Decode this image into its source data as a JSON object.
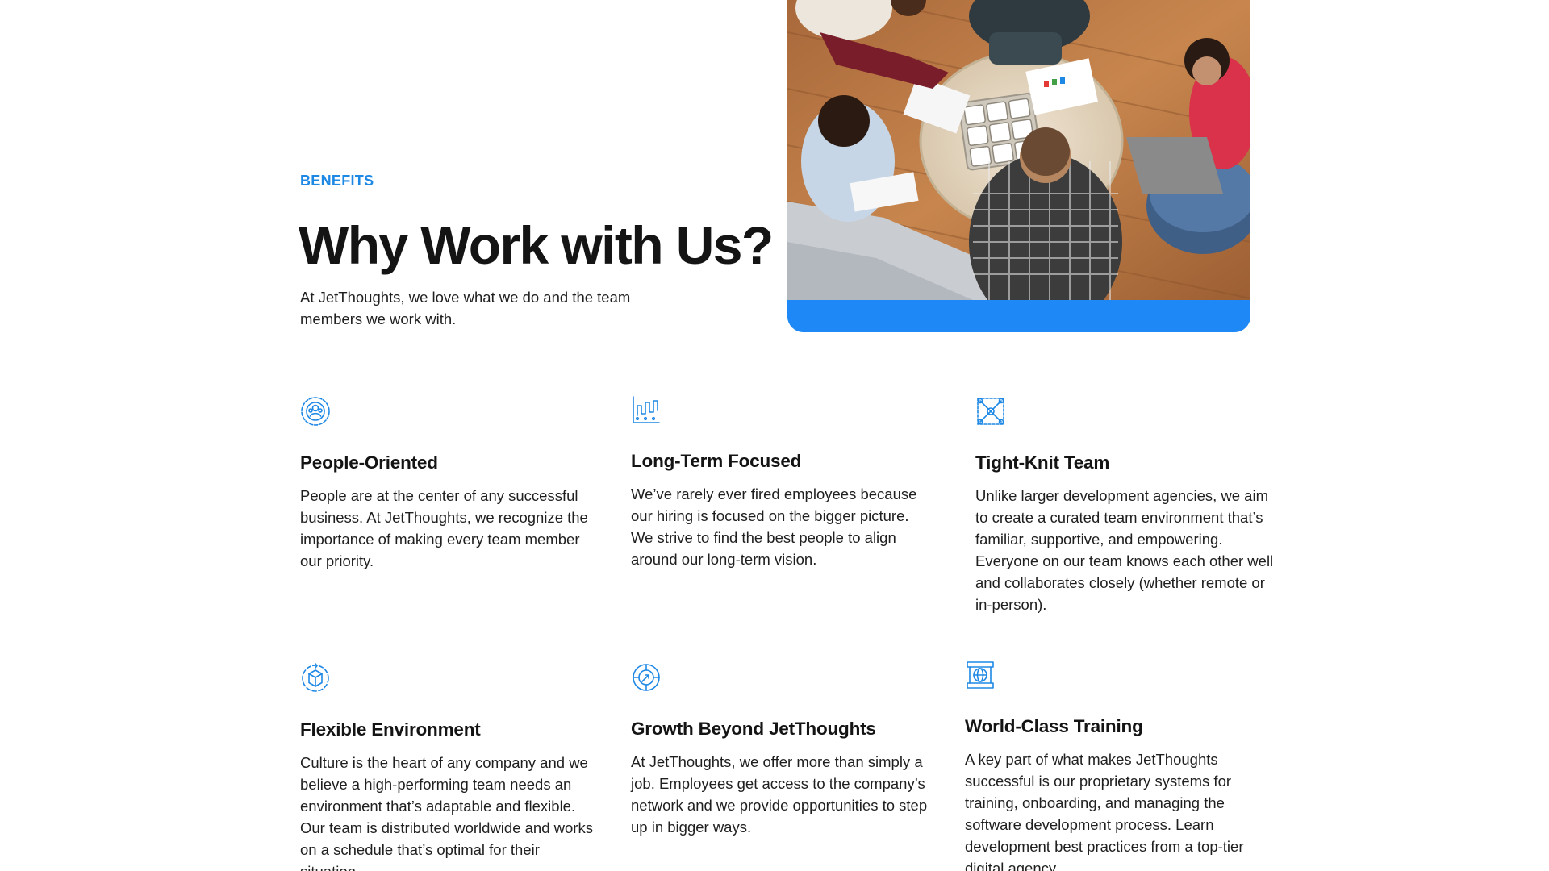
{
  "section": {
    "eyebrow": "BENEFITS",
    "title": "Why Work with Us?",
    "intro": "At JetThoughts, we love what we do and the team members we work with."
  },
  "colors": {
    "accent": "#1e88e5",
    "hero_band": "#1e88f7",
    "text": "#1a1a1a"
  },
  "benefits": [
    {
      "icon": "people-circle-icon",
      "title": "People-Oriented",
      "text": "People are at the center of any successful business. At JetThoughts, we recognize the importance of making every team member our priority."
    },
    {
      "icon": "growth-chart-icon",
      "title": "Long-Term Focused",
      "text": "We’ve rarely ever fired employees because our hiring is focused on the bigger picture. We strive to find the best people to align around our long-term vision."
    },
    {
      "icon": "network-nodes-icon",
      "title": "Tight-Knit Team",
      "text": "Unlike larger development agencies, we aim to create a curated team environment that’s familiar, supportive, and empowering. Everyone on our team knows each other well and collaborates closely (whether remote or in-person)."
    },
    {
      "icon": "flexible-cube-icon",
      "title": "Flexible Environment",
      "text": "Culture is the heart of any company and we believe a high-performing team needs an environment that’s adaptable and flexible. Our team is distributed worldwide and works on a schedule that’s optimal for their situation."
    },
    {
      "icon": "growth-compass-icon",
      "title": "Growth Beyond JetThoughts",
      "text": "At JetThoughts, we offer more than simply a job. Employees get access to the company’s network and we provide opportunities to step up in bigger ways."
    },
    {
      "icon": "training-globe-icon",
      "title": "World-Class Training",
      "text": "A key part of what makes JetThoughts successful is our proprietary systems for training, onboarding, and managing the software development process. Learn development best practices from a top-tier digital agency."
    }
  ]
}
